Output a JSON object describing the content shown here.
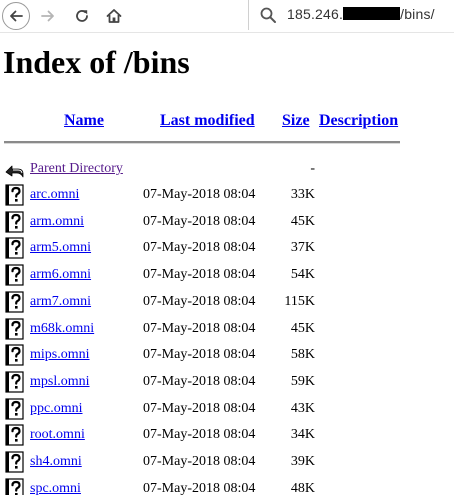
{
  "browser": {
    "back_icon": "back-arrow-icon",
    "forward_icon": "forward-arrow-icon",
    "reload_icon": "reload-icon",
    "home_icon": "home-icon",
    "url_prefix": "185.246.",
    "url_suffix": "/bins/"
  },
  "page": {
    "title": "Index of /bins"
  },
  "listing": {
    "headers": {
      "name": "Name",
      "last_modified": "Last modified",
      "size": "Size",
      "description": "Description"
    },
    "parent": {
      "label": "Parent Directory",
      "size": "-"
    },
    "files": [
      {
        "name": "arc.omni",
        "modified": "07-May-2018 08:04",
        "size": "33K"
      },
      {
        "name": "arm.omni",
        "modified": "07-May-2018 08:04",
        "size": "45K"
      },
      {
        "name": "arm5.omni",
        "modified": "07-May-2018 08:04",
        "size": "37K"
      },
      {
        "name": "arm6.omni",
        "modified": "07-May-2018 08:04",
        "size": "54K"
      },
      {
        "name": "arm7.omni",
        "modified": "07-May-2018 08:04",
        "size": "115K"
      },
      {
        "name": "m68k.omni",
        "modified": "07-May-2018 08:04",
        "size": "45K"
      },
      {
        "name": "mips.omni",
        "modified": "07-May-2018 08:04",
        "size": "58K"
      },
      {
        "name": "mpsl.omni",
        "modified": "07-May-2018 08:04",
        "size": "59K"
      },
      {
        "name": "ppc.omni",
        "modified": "07-May-2018 08:04",
        "size": "43K"
      },
      {
        "name": "root.omni",
        "modified": "07-May-2018 08:04",
        "size": "34K"
      },
      {
        "name": "sh4.omni",
        "modified": "07-May-2018 08:04",
        "size": "39K"
      },
      {
        "name": "spc.omni",
        "modified": "07-May-2018 08:04",
        "size": "48K"
      }
    ]
  }
}
